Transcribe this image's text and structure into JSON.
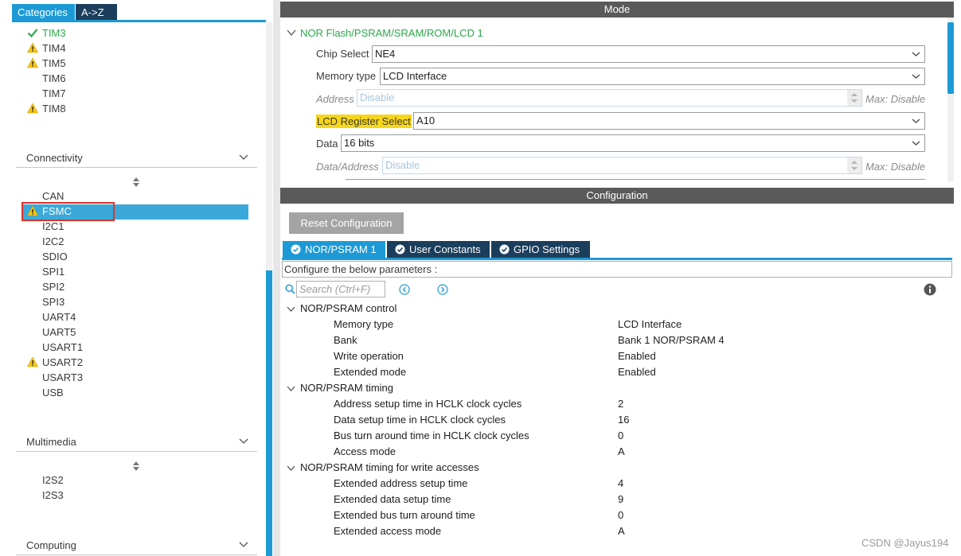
{
  "left": {
    "tabs": {
      "categories": "Categories",
      "az": "A->Z"
    },
    "timers": [
      {
        "label": "TIM3",
        "status": "check"
      },
      {
        "label": "TIM4",
        "status": "warning"
      },
      {
        "label": "TIM5",
        "status": "warning"
      },
      {
        "label": "TIM6",
        "status": "none"
      },
      {
        "label": "TIM7",
        "status": "none"
      },
      {
        "label": "TIM8",
        "status": "warning"
      }
    ],
    "connectivity": {
      "title": "Connectivity",
      "items": [
        {
          "label": "CAN",
          "status": "none"
        },
        {
          "label": "FSMC",
          "status": "warning",
          "selected": true
        },
        {
          "label": "I2C1",
          "status": "none"
        },
        {
          "label": "I2C2",
          "status": "none"
        },
        {
          "label": "SDIO",
          "status": "none"
        },
        {
          "label": "SPI1",
          "status": "none"
        },
        {
          "label": "SPI2",
          "status": "none"
        },
        {
          "label": "SPI3",
          "status": "none"
        },
        {
          "label": "UART4",
          "status": "none"
        },
        {
          "label": "UART5",
          "status": "none"
        },
        {
          "label": "USART1",
          "status": "none"
        },
        {
          "label": "USART2",
          "status": "warning"
        },
        {
          "label": "USART3",
          "status": "none"
        },
        {
          "label": "USB",
          "status": "none"
        }
      ]
    },
    "multimedia": {
      "title": "Multimedia",
      "items": [
        "I2S2",
        "I2S3"
      ]
    },
    "computing": {
      "title": "Computing"
    }
  },
  "mode": {
    "title": "Mode",
    "tree_label": "NOR Flash/PSRAM/SRAM/ROM/LCD 1",
    "chip_select": {
      "label": "Chip Select",
      "value": "NE4"
    },
    "memory_type": {
      "label": "Memory type",
      "value": "LCD Interface"
    },
    "address": {
      "label": "Address",
      "value": "Disable",
      "max": "Max: Disable"
    },
    "lcd_register_select": {
      "label": "LCD Register Select",
      "value": "A10"
    },
    "data": {
      "label": "Data",
      "value": "16 bits"
    },
    "data_address": {
      "label": "Data/Address",
      "value": "Disable",
      "max": "Max: Disable"
    }
  },
  "config": {
    "title": "Configuration",
    "reset_label": "Reset Configuration",
    "tabs": [
      "NOR/PSRAM 1",
      "User Constants",
      "GPIO Settings"
    ],
    "description": "Configure the below parameters :",
    "search_placeholder": "Search (Ctrl+F)",
    "groups": [
      {
        "title": "NOR/PSRAM control",
        "params": [
          {
            "name": "Memory type",
            "value": "LCD Interface"
          },
          {
            "name": "Bank",
            "value": "Bank 1 NOR/PSRAM 4"
          },
          {
            "name": "Write operation",
            "value": "Enabled"
          },
          {
            "name": "Extended mode",
            "value": "Enabled"
          }
        ]
      },
      {
        "title": "NOR/PSRAM timing",
        "params": [
          {
            "name": "Address setup time in HCLK clock cycles",
            "value": "2"
          },
          {
            "name": "Data setup time in HCLK clock cycles",
            "value": "16"
          },
          {
            "name": "Bus turn around time in HCLK clock cycles",
            "value": "0"
          },
          {
            "name": "Access mode",
            "value": "A"
          }
        ]
      },
      {
        "title": "NOR/PSRAM timing for write accesses",
        "params": [
          {
            "name": "Extended address setup time",
            "value": "4"
          },
          {
            "name": "Extended data setup time",
            "value": "9"
          },
          {
            "name": "Extended bus turn around time",
            "value": "0"
          },
          {
            "name": "Extended access mode",
            "value": "A"
          }
        ]
      }
    ]
  },
  "watermark": "CSDN @Jayus194",
  "colors": {
    "accent": "#1d9ad6",
    "dark_tab": "#1b3e5c",
    "header": "#5a5a5a",
    "ok_green": "#2aa84a",
    "warning": "#f7d617",
    "selection": "#3aa9da",
    "highlight_box": "#e0312b"
  }
}
